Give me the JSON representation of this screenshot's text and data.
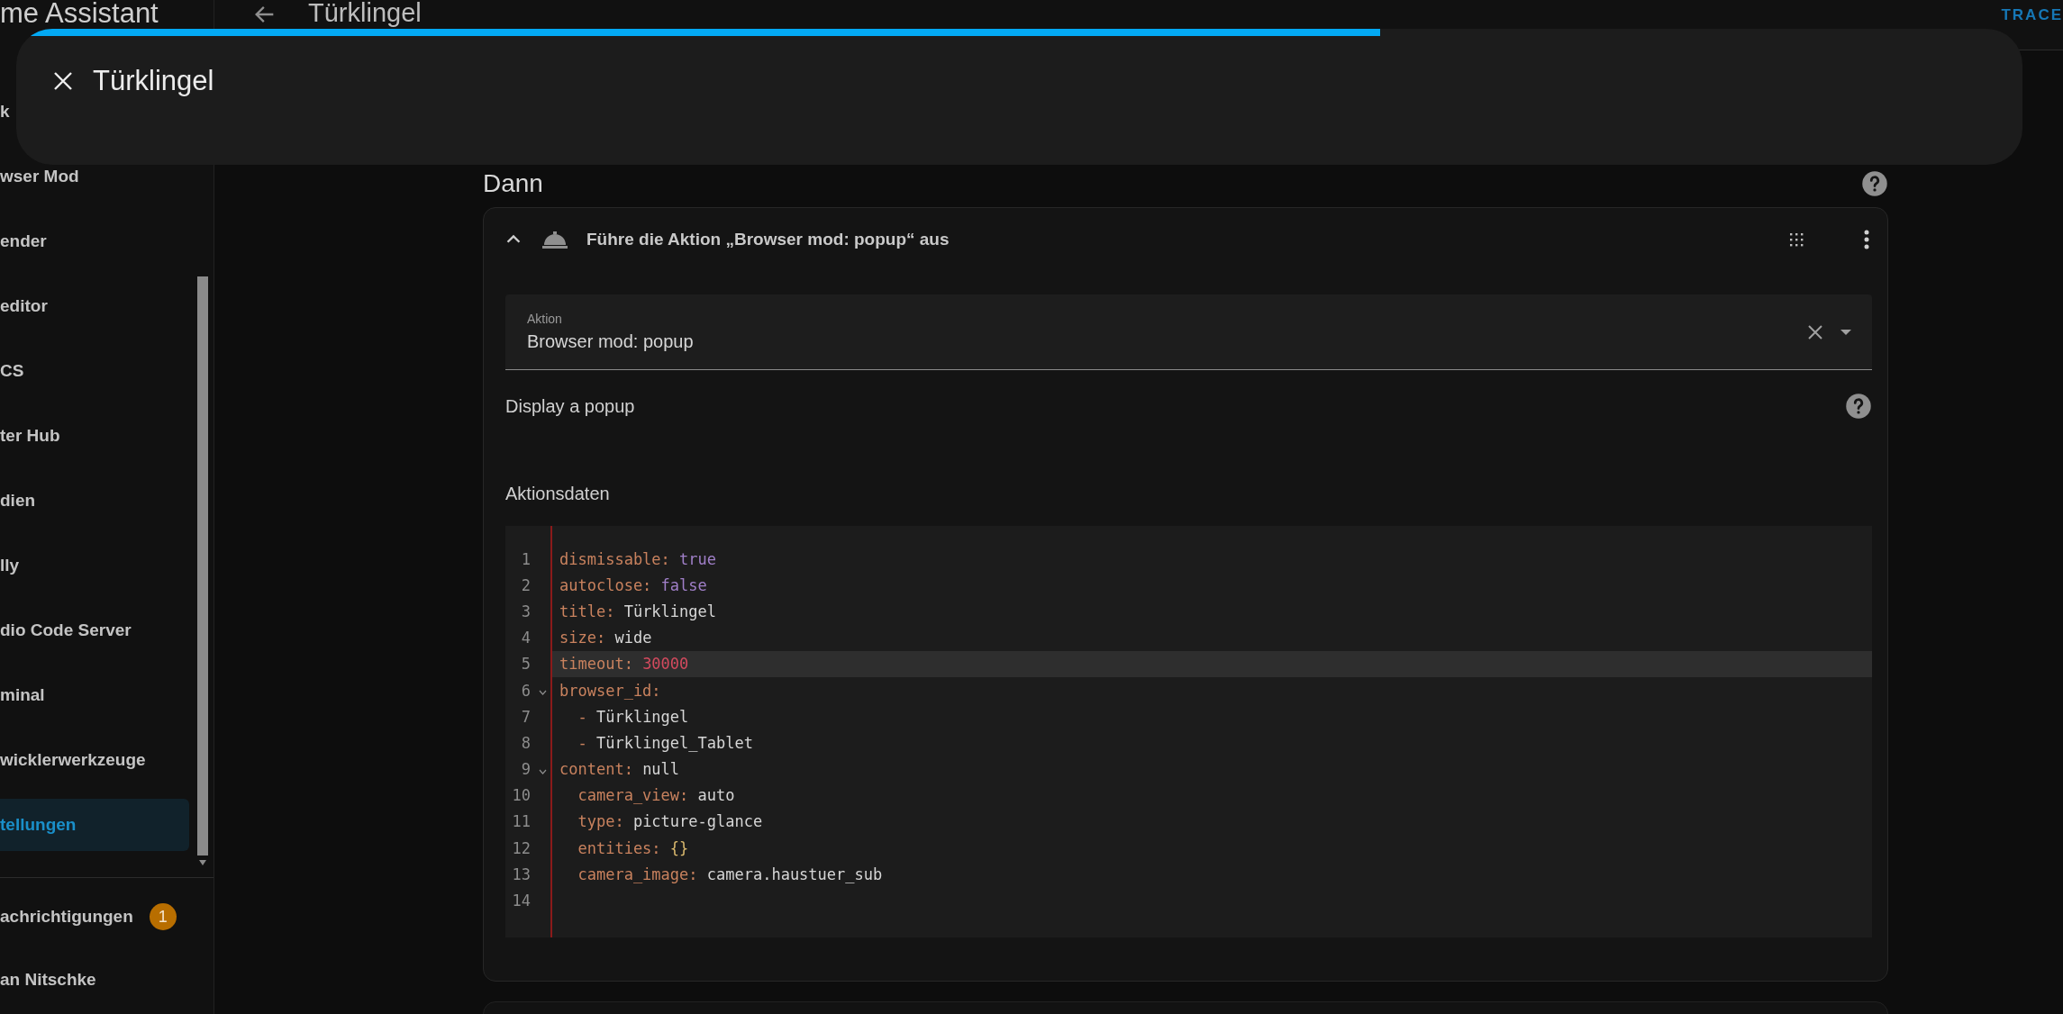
{
  "sidebar": {
    "title": "me Assistant",
    "items": [
      {
        "label": "k",
        "selected": false
      },
      {
        "label": "wser Mod",
        "selected": false
      },
      {
        "label": "ender",
        "selected": false
      },
      {
        "label": "editor",
        "selected": false
      },
      {
        "label": "CS",
        "selected": false
      },
      {
        "label": "ter Hub",
        "selected": false
      },
      {
        "label": "dien",
        "selected": false
      },
      {
        "label": "lly",
        "selected": false
      },
      {
        "label": "dio Code Server",
        "selected": false
      },
      {
        "label": "minal",
        "selected": false
      },
      {
        "label": "wicklerwerkzeuge",
        "selected": false
      },
      {
        "label": "tellungen",
        "selected": true
      }
    ],
    "notifications": {
      "label": "achrichtigungen",
      "count": "1"
    },
    "user": "an Nitschke"
  },
  "topbar": {
    "title": "Türklingel",
    "action": "TRACE"
  },
  "dialog": {
    "title": "Türklingel",
    "progress": {
      "level": 0.68
    }
  },
  "section": {
    "title": "Dann"
  },
  "action_card": {
    "title": "Führe die Aktion „Browser mod: popup“ aus",
    "expanded": true,
    "field": {
      "label": "Aktion",
      "value": "Browser mod: popup"
    },
    "description": "Display a popup",
    "data_label": "Aktionsdaten",
    "code": [
      {
        "number": "1",
        "foldable": false,
        "active": false,
        "tokens": [
          {
            "kind": "key",
            "text": "dismissable:"
          },
          {
            "kind": "bool",
            "text": " true"
          }
        ]
      },
      {
        "number": "2",
        "foldable": false,
        "active": false,
        "tokens": [
          {
            "kind": "key",
            "text": "autoclose:"
          },
          {
            "kind": "bool",
            "text": " false"
          }
        ]
      },
      {
        "number": "3",
        "foldable": false,
        "active": false,
        "tokens": [
          {
            "kind": "key",
            "text": "title:"
          },
          {
            "kind": "string",
            "text": " Türklingel"
          }
        ]
      },
      {
        "number": "4",
        "foldable": false,
        "active": false,
        "tokens": [
          {
            "kind": "key",
            "text": "size:"
          },
          {
            "kind": "string",
            "text": " wide"
          }
        ]
      },
      {
        "number": "5",
        "foldable": false,
        "active": true,
        "tokens": [
          {
            "kind": "key",
            "text": "timeout:"
          },
          {
            "kind": "number",
            "text": " 30000"
          }
        ]
      },
      {
        "number": "6",
        "foldable": true,
        "active": false,
        "tokens": [
          {
            "kind": "key",
            "text": "browser_id:"
          }
        ]
      },
      {
        "number": "7",
        "foldable": false,
        "active": false,
        "tokens": [
          {
            "kind": "key",
            "text": "  -"
          },
          {
            "kind": "string",
            "text": " Türklingel"
          }
        ]
      },
      {
        "number": "8",
        "foldable": false,
        "active": false,
        "tokens": [
          {
            "kind": "key",
            "text": "  -"
          },
          {
            "kind": "string",
            "text": " Türklingel_Tablet"
          }
        ]
      },
      {
        "number": "9",
        "foldable": true,
        "active": false,
        "tokens": [
          {
            "kind": "key",
            "text": "content:"
          },
          {
            "kind": "string",
            "text": " null"
          }
        ]
      },
      {
        "number": "10",
        "foldable": false,
        "active": false,
        "tokens": [
          {
            "kind": "key",
            "text": "  camera_view:"
          },
          {
            "kind": "string",
            "text": " auto"
          }
        ]
      },
      {
        "number": "11",
        "foldable": false,
        "active": false,
        "tokens": [
          {
            "kind": "key",
            "text": "  type:"
          },
          {
            "kind": "string",
            "text": " picture-glance"
          }
        ]
      },
      {
        "number": "12",
        "foldable": false,
        "active": false,
        "tokens": [
          {
            "kind": "key",
            "text": "  entities:"
          },
          {
            "kind": "bracket",
            "text": " {}"
          }
        ]
      },
      {
        "number": "13",
        "foldable": false,
        "active": false,
        "tokens": [
          {
            "kind": "key",
            "text": "  camera_image:"
          },
          {
            "kind": "string",
            "text": " camera.haustuer_sub"
          }
        ]
      },
      {
        "number": "14",
        "foldable": false,
        "active": false
      }
    ]
  }
}
